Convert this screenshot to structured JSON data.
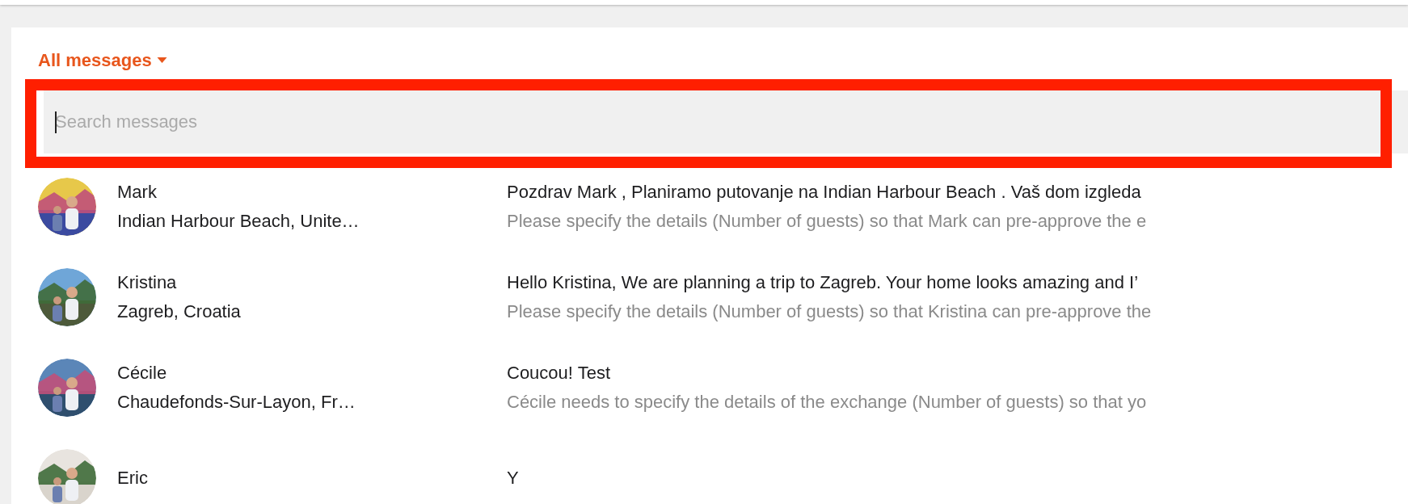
{
  "filter": {
    "label": "All messages"
  },
  "search": {
    "placeholder": "Search messages"
  },
  "conversations": [
    {
      "name": "Mark",
      "location": "Indian Harbour Beach, Unite…",
      "message": "Pozdrav Mark , Planiramo putovanje na Indian Harbour Beach . Vaš dom izgleda",
      "preview": "Please specify the details (Number of guests) so that Mark can pre-approve the e"
    },
    {
      "name": "Kristina",
      "location": "Zagreb, Croatia",
      "message": "Hello Kristina, We are planning a trip to Zagreb. Your home looks amazing and I’",
      "preview": "Please specify the details (Number of guests) so that Kristina can pre-approve the"
    },
    {
      "name": "Cécile",
      "location": "Chaudefonds-Sur-Layon, Fr…",
      "message": "Coucou! Test",
      "preview": "Cécile needs to specify the details of the exchange (Number of guests) so that yo"
    },
    {
      "name": "Eric",
      "message": "Y"
    }
  ]
}
